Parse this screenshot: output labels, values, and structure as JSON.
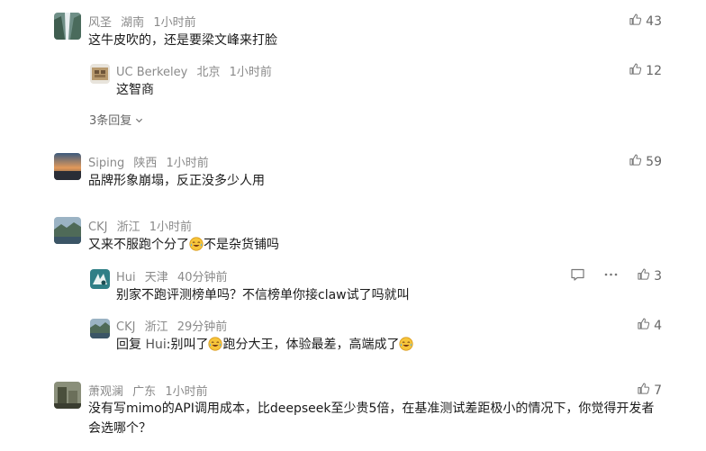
{
  "comments": [
    {
      "name": "风圣",
      "location": "湖南",
      "time": "1小时前",
      "text": "这牛皮吹的，还是要梁文峰来打脸",
      "likes": "43",
      "replies": [
        {
          "name": "UC Berkeley",
          "location": "北京",
          "time": "1小时前",
          "text": "这智商",
          "likes": "12"
        }
      ],
      "more_replies_label": "3条回复"
    },
    {
      "name": "Siping",
      "location": "陕西",
      "time": "1小时前",
      "text": "品牌形象崩塌，反正没多少人用",
      "likes": "59"
    },
    {
      "name": "CKJ",
      "location": "浙江",
      "time": "1小时前",
      "text_before_emoji": "又来不服跑个分了",
      "text_after_emoji": "不是杂货铺吗",
      "replies": [
        {
          "name": "Hui",
          "location": "天津",
          "time": "40分钟前",
          "text": "别家不跑评测榜单吗？不信榜单你接claw试了吗就叫",
          "likes": "3"
        },
        {
          "name": "CKJ",
          "location": "浙江",
          "time": "29分钟前",
          "text_part1": "回复 ",
          "reply_to": "Hui",
          "text_part2": ":别叫了",
          "text_part3": "跑分大王，体验最差，高端成了",
          "likes": "4"
        }
      ]
    },
    {
      "name": "萧观澜",
      "location": "广东",
      "time": "1小时前",
      "text": "没有写mimo的API调用成本，比deepseek至少贵5倍，在基准测试差距极小的情况下，你觉得开发者会选哪个？",
      "likes": "7"
    }
  ],
  "icons": {
    "like": "thumbs-up-icon",
    "reply": "comment-icon",
    "more": "more-dots-icon",
    "expand": "chevron-down-icon",
    "emoji": "laughing-tears-emoji"
  }
}
